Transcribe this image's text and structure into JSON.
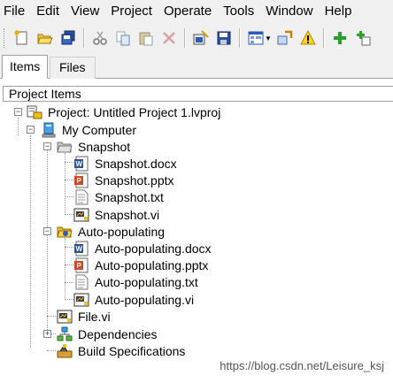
{
  "menu": [
    "File",
    "Edit",
    "View",
    "Project",
    "Operate",
    "Tools",
    "Window",
    "Help"
  ],
  "toolbar": {
    "icons": [
      "new-icon",
      "open-icon",
      "save-all-icon",
      "cut-icon",
      "copy-icon",
      "paste-icon",
      "delete-icon",
      "build-icon",
      "save-icon",
      "view-icon",
      "properties-icon",
      "warning-icon",
      "add-icon",
      "add-folder-icon"
    ]
  },
  "tabs": {
    "items": "Items",
    "files": "Files"
  },
  "panel": {
    "header": "Project Items"
  },
  "tree": {
    "project": "Project: Untitled Project 1.lvproj",
    "computer": "My Computer",
    "snapshot": "Snapshot",
    "snapshot_docx": "Snapshot.docx",
    "snapshot_pptx": "Snapshot.pptx",
    "snapshot_txt": "Snapshot.txt",
    "snapshot_vi": "Snapshot.vi",
    "autopop": "Auto-populating",
    "autopop_docx": "Auto-populating.docx",
    "autopop_pptx": "Auto-populating.pptx",
    "autopop_txt": "Auto-populating.txt",
    "autopop_vi": "Auto-populating.vi",
    "file_vi": "File.vi",
    "dependencies": "Dependencies",
    "build_specs": "Build Specifications"
  },
  "watermark": "https://blog.csdn.net/Leisure_ksj"
}
